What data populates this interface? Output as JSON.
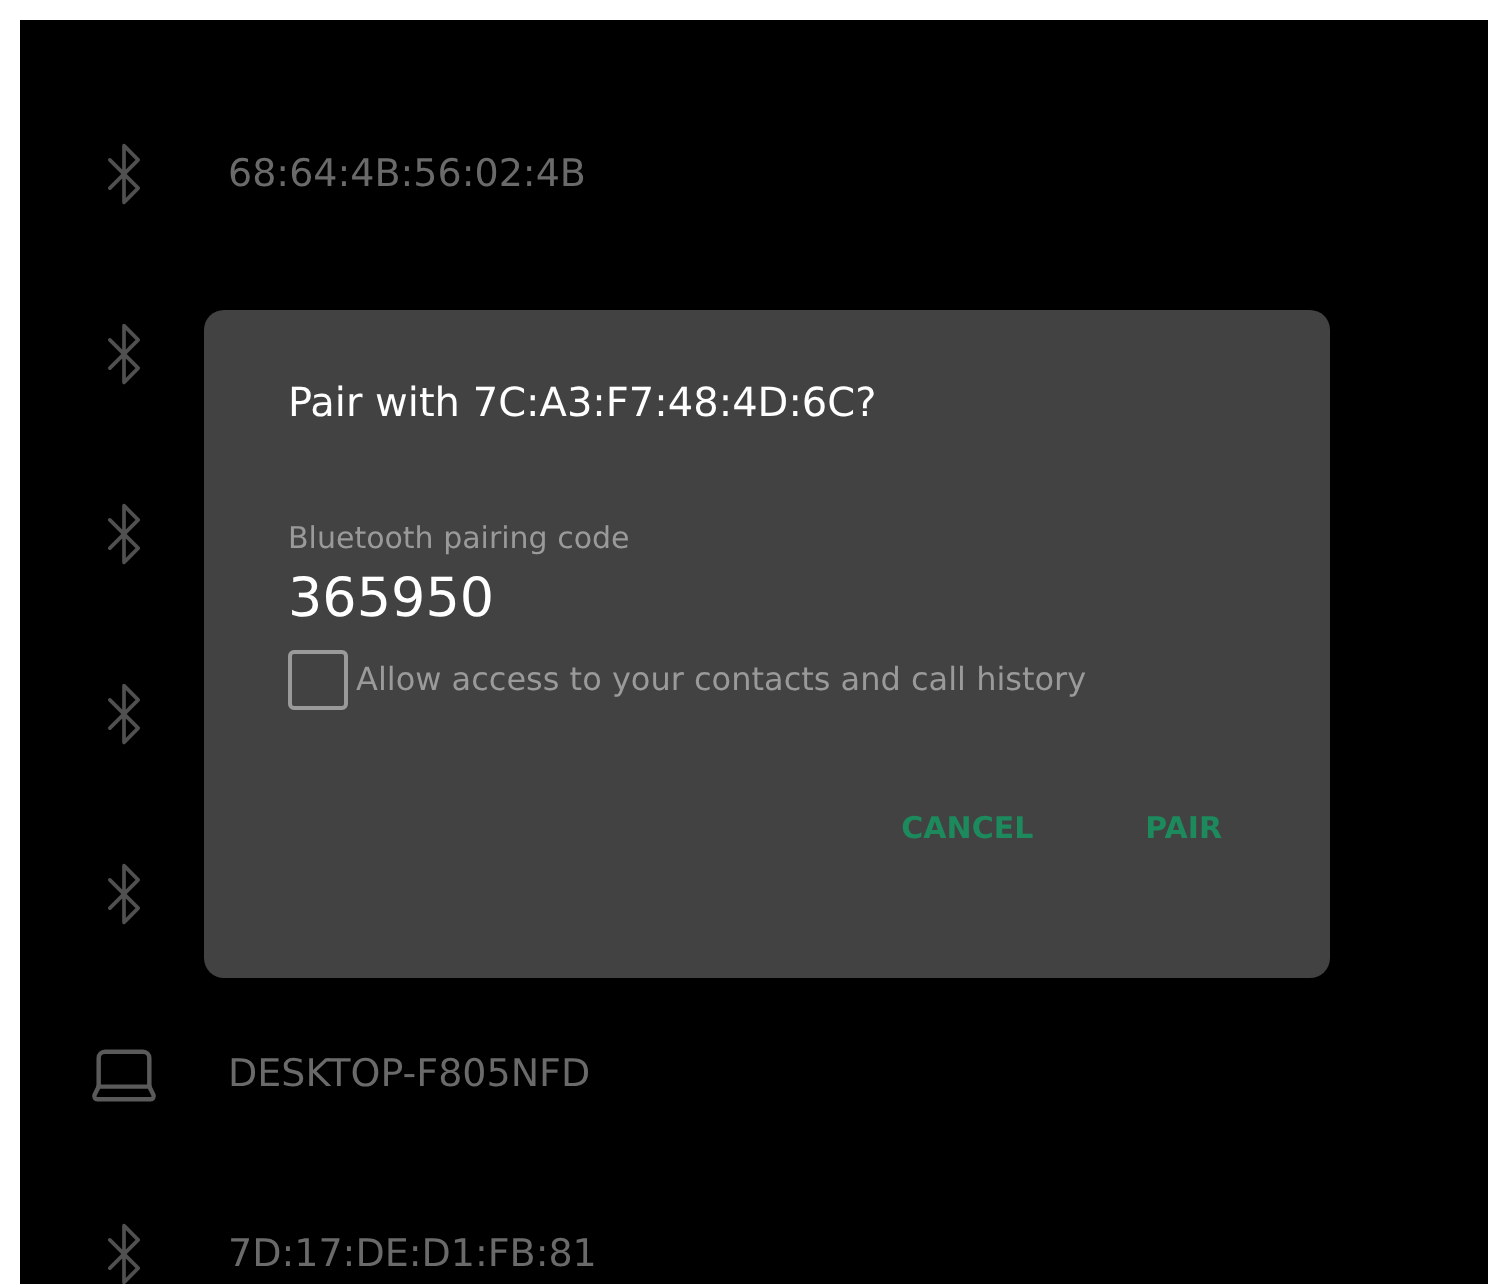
{
  "devices": [
    {
      "kind": "bluetooth",
      "name": "68:64:4B:56:02:4B"
    },
    {
      "kind": "bluetooth"
    },
    {
      "kind": "bluetooth"
    },
    {
      "kind": "bluetooth"
    },
    {
      "kind": "bluetooth"
    },
    {
      "kind": "laptop",
      "name": "DESKTOP-F805NFD"
    },
    {
      "kind": "bluetooth",
      "name": "7D:17:DE:D1:FB:81"
    }
  ],
  "dialog": {
    "title": "Pair with 7C:A3:F7:48:4D:6C?",
    "code_label": "Bluetooth pairing code",
    "code": "365950",
    "checkbox": {
      "label": "Allow access to your contacts and call history",
      "checked": false
    },
    "buttons": [
      "CANCEL",
      "PAIR"
    ]
  }
}
